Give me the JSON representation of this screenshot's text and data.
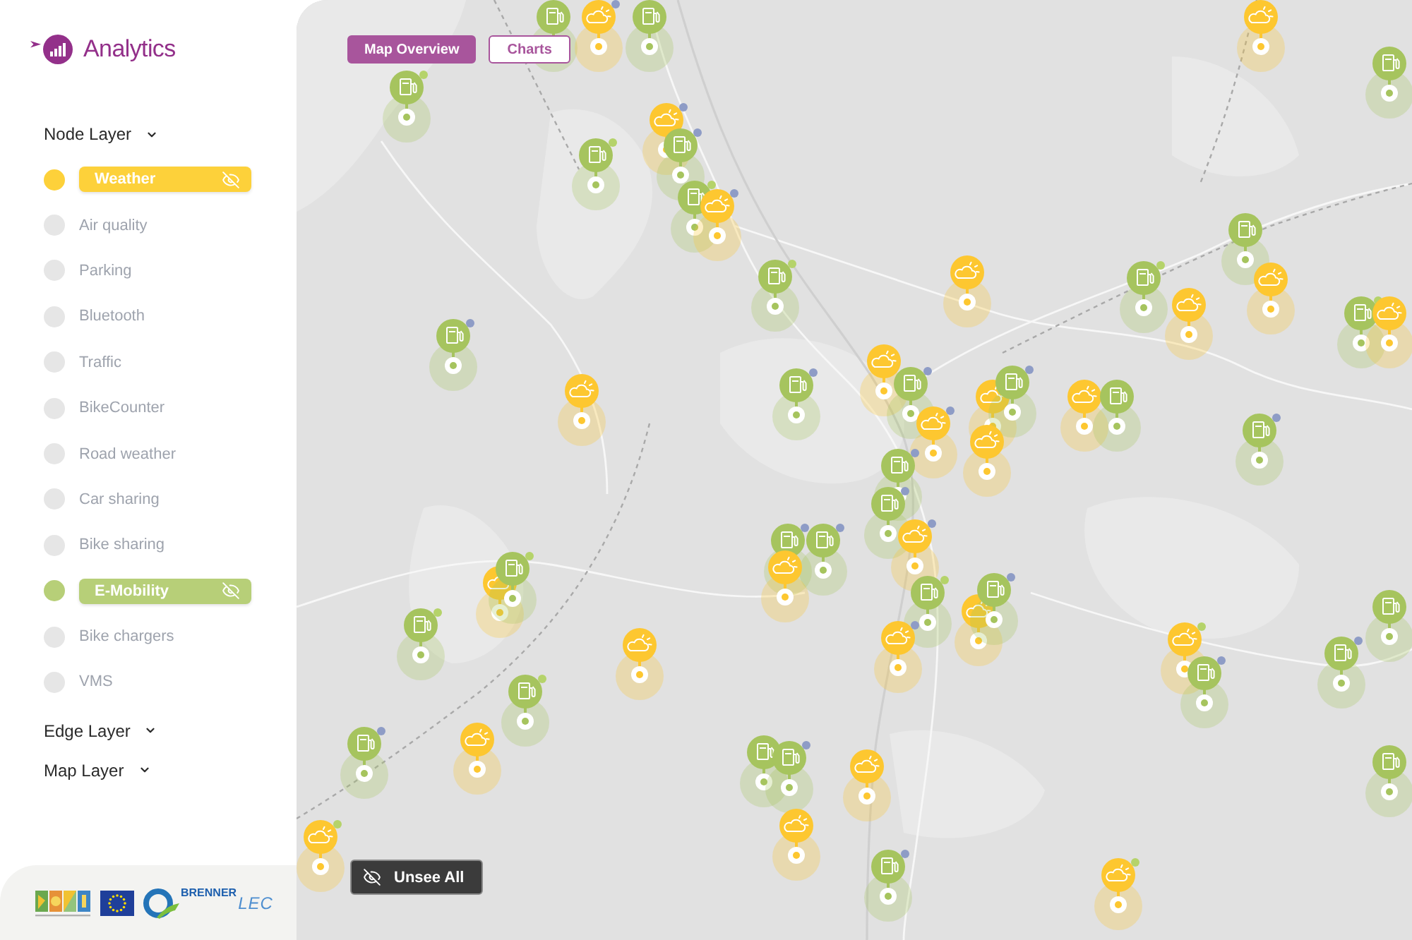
{
  "logo": {
    "title": "Analytics"
  },
  "sidebar": {
    "sections": [
      {
        "title": "Node Layer",
        "items": [
          {
            "label": "Weather",
            "selected": true,
            "color": "#fdd13a"
          },
          {
            "label": "Air quality",
            "selected": false,
            "color": "#e6e6e6"
          },
          {
            "label": "Parking",
            "selected": false,
            "color": "#e6e6e6"
          },
          {
            "label": "Bluetooth",
            "selected": false,
            "color": "#e6e6e6"
          },
          {
            "label": "Traffic",
            "selected": false,
            "color": "#e6e6e6"
          },
          {
            "label": "BikeCounter",
            "selected": false,
            "color": "#e6e6e6"
          },
          {
            "label": "Road weather",
            "selected": false,
            "color": "#e6e6e6"
          },
          {
            "label": "Car sharing",
            "selected": false,
            "color": "#e6e6e6"
          },
          {
            "label": "Bike sharing",
            "selected": false,
            "color": "#e6e6e6"
          },
          {
            "label": "E-Mobility",
            "selected": true,
            "color": "#b7cf78"
          },
          {
            "label": "Bike chargers",
            "selected": false,
            "color": "#e6e6e6"
          },
          {
            "label": "VMS",
            "selected": false,
            "color": "#e6e6e6"
          }
        ]
      },
      {
        "title": "Edge Layer"
      },
      {
        "title": "Map Layer"
      }
    ]
  },
  "footer": {
    "brand_name": "BRENNER",
    "brand_suffix": "LEC"
  },
  "view_tabs": [
    {
      "label": "Map Overview",
      "selected": true
    },
    {
      "label": "Charts",
      "selected": false
    }
  ],
  "map": {
    "unsee_button": {
      "label": "Unsee All"
    }
  }
}
